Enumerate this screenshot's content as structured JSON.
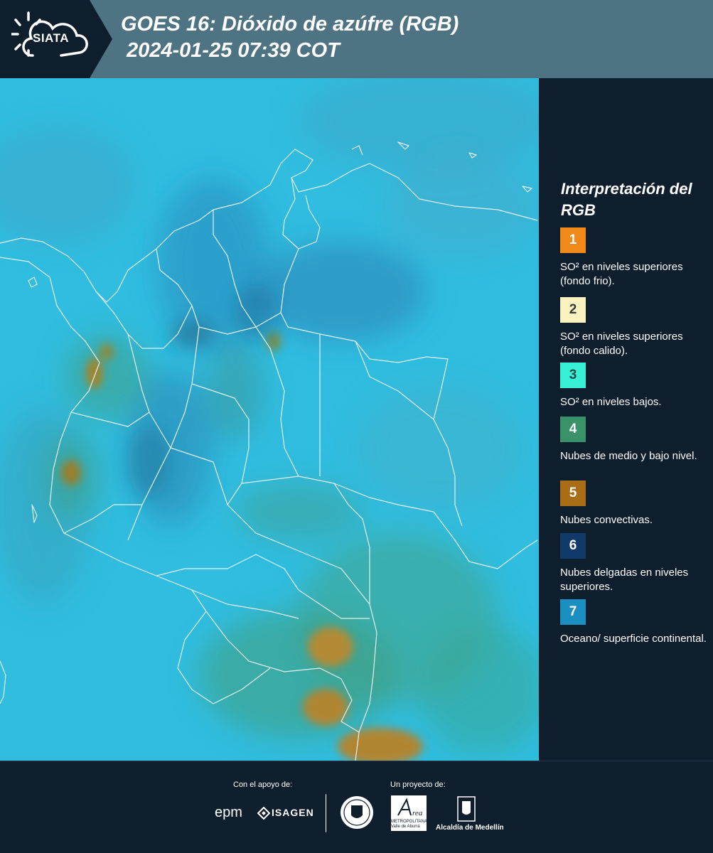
{
  "header": {
    "logo_text": "SIATA",
    "title": "GOES 16: Dióxido de azúfre (RGB)",
    "subtitle": "2024-01-25 07:39 COT"
  },
  "map": {
    "background_color": "#30bde0",
    "border_color": "#e6f0f2",
    "product": "SO2 RGB composite"
  },
  "legend": {
    "title": "Interpretación del RGB",
    "items": [
      {
        "number": "1",
        "color": "#f28a1b",
        "number_color": "#ffffff",
        "text": "SO² en niveles superiores (fondo frio)."
      },
      {
        "number": "2",
        "color": "#fbf3bf",
        "number_color": "#3a3a3a",
        "text": "SO² en niveles superiores (fondo calido)."
      },
      {
        "number": "3",
        "color": "#38f0d6",
        "number_color": "#2a4a4a",
        "text": "SO² en niveles bajos."
      },
      {
        "number": "4",
        "color": "#3a9268",
        "number_color": "#ffffff",
        "text": "Nubes de medio y bajo nivel."
      },
      {
        "number": "5",
        "color": "#a96d17",
        "number_color": "#ffffff",
        "text": "Nubes convectivas."
      },
      {
        "number": "6",
        "color": "#103a6a",
        "number_color": "#ffffff",
        "text": "Nubes delgadas en niveles superiores."
      },
      {
        "number": "7",
        "color": "#1b8fc2",
        "number_color": "#ffffff",
        "text": "Oceano/ superficie continental."
      }
    ]
  },
  "footer": {
    "support_label": "Con el apoyo de:",
    "project_label": "Un proyecto de:",
    "sponsor_1": "epm",
    "sponsor_2": "ISAGEN",
    "partner_1_sub": "METROPOLITANA Valle de Aburrá",
    "partner_2": "Alcaldía de Medellín"
  }
}
